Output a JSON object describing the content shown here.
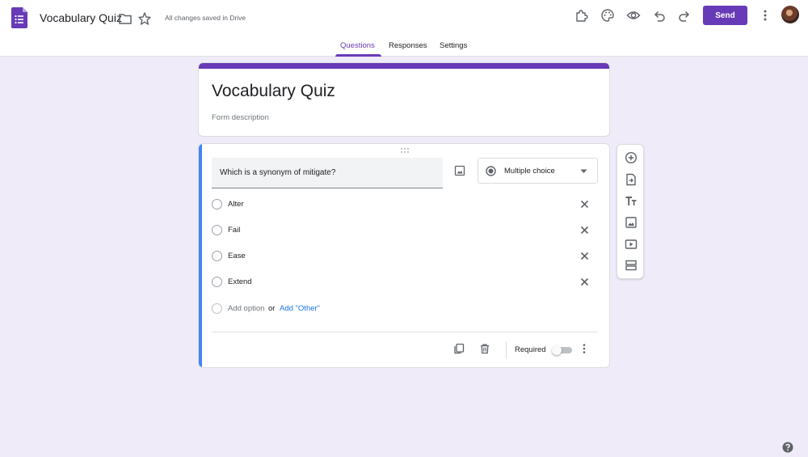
{
  "header": {
    "doc_title": "Vocabulary Quiz",
    "save_status": "All changes saved in Drive",
    "send_label": "Send",
    "icons": [
      "forms-logo-icon",
      "folder-icon",
      "star-icon",
      "addon-puzzle-icon",
      "palette-icon",
      "preview-eye-icon",
      "undo-icon",
      "redo-icon",
      "more-vert-icon",
      "avatar"
    ],
    "accent_color": "#673ab7"
  },
  "tabs": [
    {
      "label": "Questions",
      "active": true
    },
    {
      "label": "Responses",
      "active": false
    },
    {
      "label": "Settings",
      "active": false
    }
  ],
  "form": {
    "title": "Vocabulary Quiz",
    "description_placeholder": "Form description"
  },
  "question": {
    "text": "Which is a synonym of mitigate?",
    "type": "Multiple choice",
    "options": [
      {
        "label": "Alter"
      },
      {
        "label": "Fail"
      },
      {
        "label": "Ease"
      },
      {
        "label": "Extend"
      }
    ],
    "add_option": "Add option",
    "or_text": "or",
    "add_other": "Add \"Other\"",
    "required_label": "Required",
    "required": false
  },
  "toolbar": {
    "icons": [
      "add-question-icon",
      "import-questions-icon",
      "add-title-icon",
      "add-image-icon",
      "add-video-icon",
      "add-section-icon"
    ]
  }
}
